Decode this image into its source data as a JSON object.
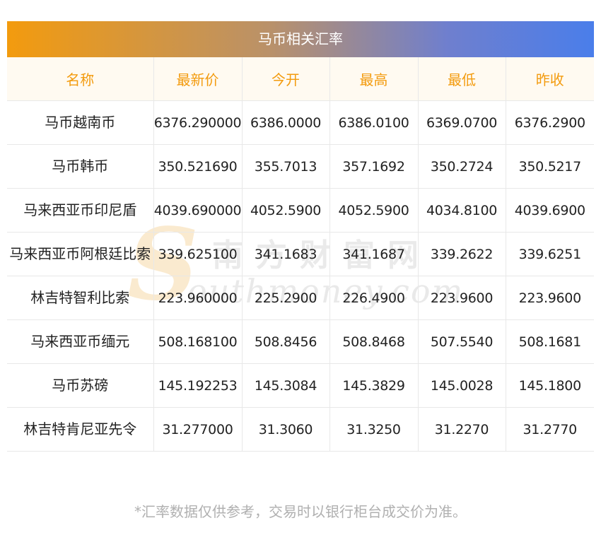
{
  "title": "马币相关汇率",
  "columns": [
    "名称",
    "最新价",
    "今开",
    "最高",
    "最低",
    "昨收"
  ],
  "rows": [
    {
      "name": "马币越南币",
      "latest": "6376.290000",
      "open": "6386.0000",
      "high": "6386.0100",
      "low": "6369.0700",
      "prev_close": "6376.2900"
    },
    {
      "name": "马币韩币",
      "latest": "350.521690",
      "open": "355.7013",
      "high": "357.1692",
      "low": "350.2724",
      "prev_close": "350.5217"
    },
    {
      "name": "马来西亚币印尼盾",
      "latest": "4039.690000",
      "open": "4052.5900",
      "high": "4052.5900",
      "low": "4034.8100",
      "prev_close": "4039.6900"
    },
    {
      "name": "马来西亚币阿根廷比索",
      "latest": "339.625100",
      "open": "341.1683",
      "high": "341.1687",
      "low": "339.2622",
      "prev_close": "339.6251"
    },
    {
      "name": "林吉特智利比索",
      "latest": "223.960000",
      "open": "225.2900",
      "high": "226.4900",
      "low": "223.9600",
      "prev_close": "223.9600"
    },
    {
      "name": "马来西亚币缅元",
      "latest": "508.168100",
      "open": "508.8456",
      "high": "508.8468",
      "low": "507.5540",
      "prev_close": "508.1681"
    },
    {
      "name": "马币苏磅",
      "latest": "145.192253",
      "open": "145.3084",
      "high": "145.3829",
      "low": "145.0028",
      "prev_close": "145.1800"
    },
    {
      "name": "林吉特肯尼亚先令",
      "latest": "31.277000",
      "open": "31.3060",
      "high": "31.3250",
      "low": "31.2270",
      "prev_close": "31.2770"
    }
  ],
  "watermark": {
    "cn": "南方财富网",
    "en": "outhmoney.com",
    "initial": "S"
  },
  "note": "*汇率数据仅供参考，交易时以银行柜台成交价为准。",
  "colors": {
    "accent": "#f39b0e",
    "gradient_end": "#4a7eea",
    "header_bg": "#fffaf1",
    "note": "#b0b0b0"
  }
}
